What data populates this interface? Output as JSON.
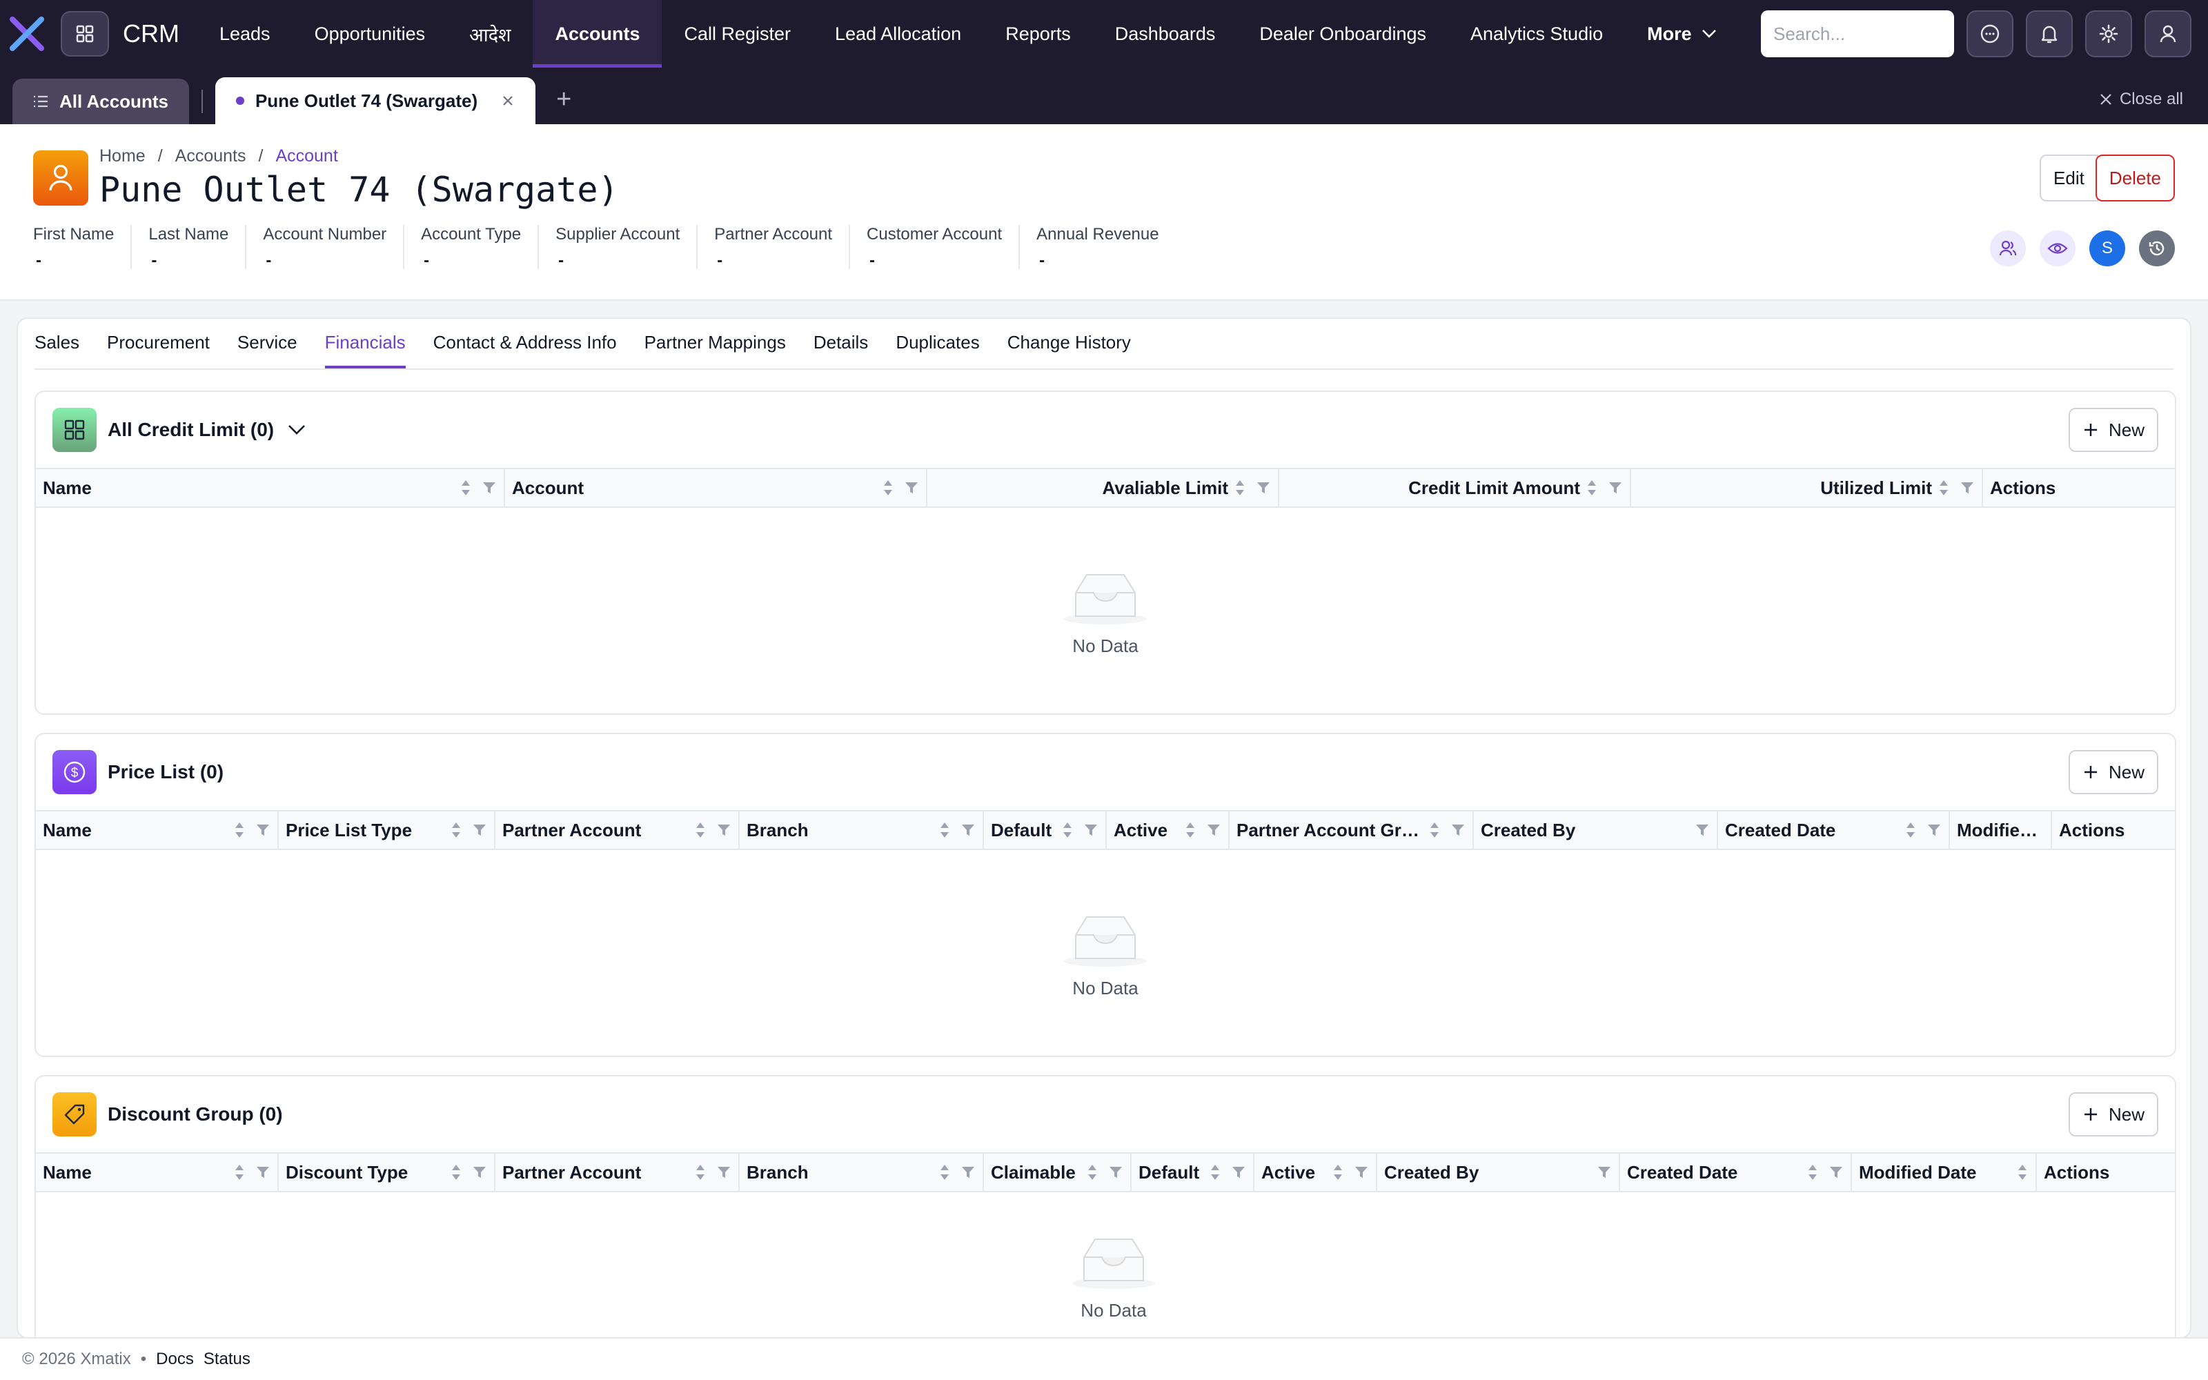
{
  "nav": {
    "brand": "CRM",
    "items": [
      {
        "label": "Leads",
        "active": false
      },
      {
        "label": "Opportunities",
        "active": false
      },
      {
        "label": "आदेश",
        "active": false
      },
      {
        "label": "Accounts",
        "active": true
      },
      {
        "label": "Call Register",
        "active": false
      },
      {
        "label": "Lead Allocation",
        "active": false
      },
      {
        "label": "Reports",
        "active": false
      },
      {
        "label": "Dashboards",
        "active": false
      },
      {
        "label": "Dealer Onboardings",
        "active": false
      },
      {
        "label": "Analytics Studio",
        "active": false
      }
    ],
    "more_label": "More",
    "search_placeholder": "Search...",
    "icons": [
      "grid-icon",
      "search-icon",
      "chat-icon",
      "bell-icon",
      "gear-icon",
      "user-icon"
    ]
  },
  "tabs": {
    "all_label": "All Accounts",
    "record_label": "Pune Outlet 74 (Swargate)",
    "add_label": "+",
    "close_all_label": "Close all"
  },
  "header": {
    "breadcrumb": [
      "Home",
      "Accounts",
      "Account"
    ],
    "breadcrumb_sep": "/",
    "title": "Pune Outlet 74 (Swargate)",
    "edit_label": "Edit",
    "delete_label": "Delete",
    "fields": [
      {
        "label": "First Name",
        "value": "-"
      },
      {
        "label": "Last Name",
        "value": "-"
      },
      {
        "label": "Account Number",
        "value": "-"
      },
      {
        "label": "Account Type",
        "value": "-"
      },
      {
        "label": "Supplier Account",
        "value": "-"
      },
      {
        "label": "Partner Account",
        "value": "-"
      },
      {
        "label": "Customer Account",
        "value": "-"
      },
      {
        "label": "Annual Revenue",
        "value": "-"
      }
    ],
    "avatar_initial": "S"
  },
  "subtabs": [
    {
      "label": "Sales",
      "active": false
    },
    {
      "label": "Procurement",
      "active": false
    },
    {
      "label": "Service",
      "active": false
    },
    {
      "label": "Financials",
      "active": true
    },
    {
      "label": "Contact & Address Info",
      "active": false
    },
    {
      "label": "Partner Mappings",
      "active": false
    },
    {
      "label": "Details",
      "active": false
    },
    {
      "label": "Duplicates",
      "active": false
    },
    {
      "label": "Change History",
      "active": false
    }
  ],
  "panels": {
    "credit": {
      "title": "All Credit Limit (0)",
      "new_label": "New",
      "empty_text": "No Data",
      "columns": [
        {
          "label": "Name",
          "sort": true,
          "filter": true
        },
        {
          "label": "Account",
          "sort": true,
          "filter": true
        },
        {
          "label": "Avaliable Limit",
          "sort": true,
          "filter": true
        },
        {
          "label": "Credit Limit Amount",
          "sort": true,
          "filter": true
        },
        {
          "label": "Utilized Limit",
          "sort": true,
          "filter": true
        },
        {
          "label": "Actions",
          "sort": false,
          "filter": false
        }
      ]
    },
    "price": {
      "title": "Price List (0)",
      "new_label": "New",
      "empty_text": "No Data",
      "columns": [
        {
          "label": "Name",
          "sort": true,
          "filter": true
        },
        {
          "label": "Price List Type",
          "sort": true,
          "filter": true
        },
        {
          "label": "Partner Account",
          "sort": true,
          "filter": true
        },
        {
          "label": "Branch",
          "sort": true,
          "filter": true
        },
        {
          "label": "Default",
          "sort": true,
          "filter": true
        },
        {
          "label": "Active",
          "sort": true,
          "filter": true
        },
        {
          "label": "Partner Account Group",
          "sort": true,
          "filter": true
        },
        {
          "label": "Created By",
          "sort": false,
          "filter": true
        },
        {
          "label": "Created Date",
          "sort": true,
          "filter": true
        },
        {
          "label": "Modified Date",
          "sort": false,
          "filter": false
        },
        {
          "label": "Actions",
          "sort": false,
          "filter": false
        }
      ]
    },
    "discount": {
      "title": "Discount Group (0)",
      "new_label": "New",
      "empty_text": "No Data",
      "columns": [
        {
          "label": "Name",
          "sort": true,
          "filter": true
        },
        {
          "label": "Discount Type",
          "sort": true,
          "filter": true
        },
        {
          "label": "Partner Account",
          "sort": true,
          "filter": true
        },
        {
          "label": "Branch",
          "sort": true,
          "filter": true
        },
        {
          "label": "Claimable",
          "sort": true,
          "filter": true
        },
        {
          "label": "Default",
          "sort": true,
          "filter": true
        },
        {
          "label": "Active",
          "sort": true,
          "filter": true
        },
        {
          "label": "Created By",
          "sort": false,
          "filter": true
        },
        {
          "label": "Created Date",
          "sort": true,
          "filter": true
        },
        {
          "label": "Modified Date",
          "sort": true,
          "filter": false
        },
        {
          "label": "Actions",
          "sort": false,
          "filter": false
        }
      ]
    }
  },
  "footer": {
    "copyright": "© 2026 Xmatix",
    "bullet": "•",
    "links": [
      "Docs",
      "Status"
    ]
  },
  "colors": {
    "nav_bg": "#1f1b2e",
    "accent": "#6d3fc8",
    "danger": "#b91c1c"
  }
}
